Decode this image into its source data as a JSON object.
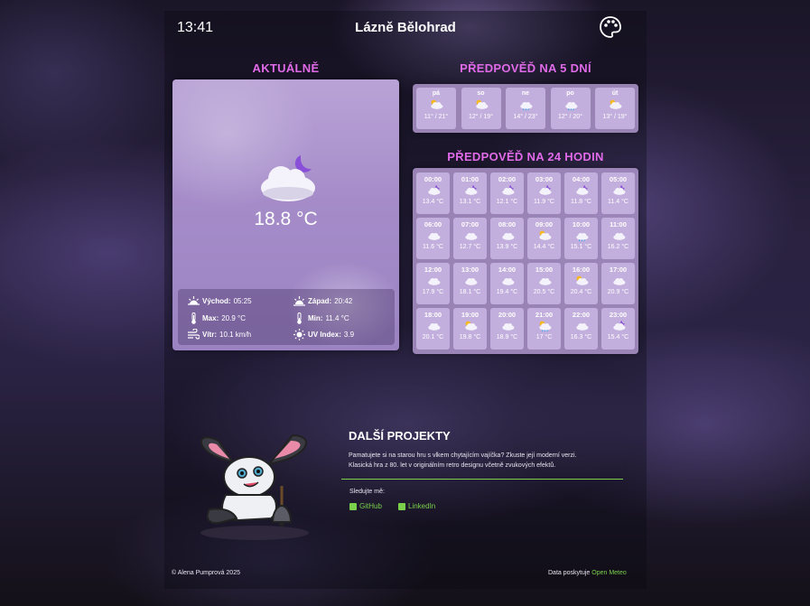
{
  "header": {
    "time": "13:41",
    "city": "Lázně Bělohrad",
    "palette_icon": "palette-icon"
  },
  "current": {
    "title": "AKTUÁLNĚ",
    "icon": "cloud-moon-icon",
    "temperature": "18.8 °C",
    "sunrise_label": "Východ:",
    "sunrise_value": "05:25",
    "sunset_label": "Západ:",
    "sunset_value": "20:42",
    "max_label": "Max:",
    "max_value": "20.9 °C",
    "min_label": "Min:",
    "min_value": "11.4 °C",
    "wind_label": "Vítr:",
    "wind_value": "10.1 km/h",
    "uv_label": "UV Index:",
    "uv_value": "3.9"
  },
  "forecast5": {
    "title": "PŘEDPOVĚĎ NA 5 DNÍ",
    "days": [
      {
        "day": "pá",
        "range": "11° / 21°",
        "icon": "sun-cloud-icon"
      },
      {
        "day": "so",
        "range": "12° / 19°",
        "icon": "sun-cloud-icon"
      },
      {
        "day": "ne",
        "range": "14° / 23°",
        "icon": "rain-cloud-icon"
      },
      {
        "day": "po",
        "range": "12° / 20°",
        "icon": "rain-cloud-icon"
      },
      {
        "day": "út",
        "range": "13° / 19°",
        "icon": "sun-cloud-icon"
      }
    ]
  },
  "forecast24": {
    "title": "PŘEDPOVĚĎ NA 24 HODIN",
    "hours": [
      {
        "time": "00:00",
        "temp": "13.4 °C",
        "icon": "moon-cloud"
      },
      {
        "time": "01:00",
        "temp": "13.1 °C",
        "icon": "moon-cloud"
      },
      {
        "time": "02:00",
        "temp": "12.1 °C",
        "icon": "moon-cloud"
      },
      {
        "time": "03:00",
        "temp": "11.9 °C",
        "icon": "moon-cloud"
      },
      {
        "time": "04:00",
        "temp": "11.8 °C",
        "icon": "moon-cloud"
      },
      {
        "time": "05:00",
        "temp": "11.4 °C",
        "icon": "moon-cloud"
      },
      {
        "time": "06:00",
        "temp": "11.6 °C",
        "icon": "cloud"
      },
      {
        "time": "07:00",
        "temp": "12.7 °C",
        "icon": "cloud"
      },
      {
        "time": "08:00",
        "temp": "13.9 °C",
        "icon": "cloud"
      },
      {
        "time": "09:00",
        "temp": "14.4 °C",
        "icon": "sun-cloud"
      },
      {
        "time": "10:00",
        "temp": "15.1 °C",
        "icon": "rain-cloud"
      },
      {
        "time": "11:00",
        "temp": "16.2 °C",
        "icon": "cloud"
      },
      {
        "time": "12:00",
        "temp": "17.9 °C",
        "icon": "cloud"
      },
      {
        "time": "13:00",
        "temp": "18.1 °C",
        "icon": "cloud"
      },
      {
        "time": "14:00",
        "temp": "19.4 °C",
        "icon": "cloud"
      },
      {
        "time": "15:00",
        "temp": "20.5 °C",
        "icon": "cloud"
      },
      {
        "time": "16:00",
        "temp": "20.4 °C",
        "icon": "sun-cloud"
      },
      {
        "time": "17:00",
        "temp": "20.9 °C",
        "icon": "cloud"
      },
      {
        "time": "18:00",
        "temp": "20.1 °C",
        "icon": "cloud"
      },
      {
        "time": "19:00",
        "temp": "19.8 °C",
        "icon": "sun-cloud"
      },
      {
        "time": "20:00",
        "temp": "18.9 °C",
        "icon": "cloud"
      },
      {
        "time": "21:00",
        "temp": "17 °C",
        "icon": "sun-rain-cloud"
      },
      {
        "time": "22:00",
        "temp": "16.3 °C",
        "icon": "cloud"
      },
      {
        "time": "23:00",
        "temp": "15.4 °C",
        "icon": "moon-cloud"
      }
    ]
  },
  "projects": {
    "title": "DALŠÍ PROJEKTY",
    "text_line1": "Pamatujete si na starou hru s vlkem chytajícím vajíčka? Zkuste její moderní verzi.",
    "text_line2": "Klasická hra z 80. let v originálním retro designu včetně zvukových efektů.",
    "follow_label": "Sledujte mě:",
    "github": "GitHub",
    "linkedin": "LinkedIn"
  },
  "footer": {
    "copyright": "© Alena Pumprová 2025",
    "data_label": "Data poskytuje",
    "data_link": "Open Meteo"
  },
  "colors": {
    "accent_title": "#e06ae8",
    "link_green": "#7ad04a"
  }
}
